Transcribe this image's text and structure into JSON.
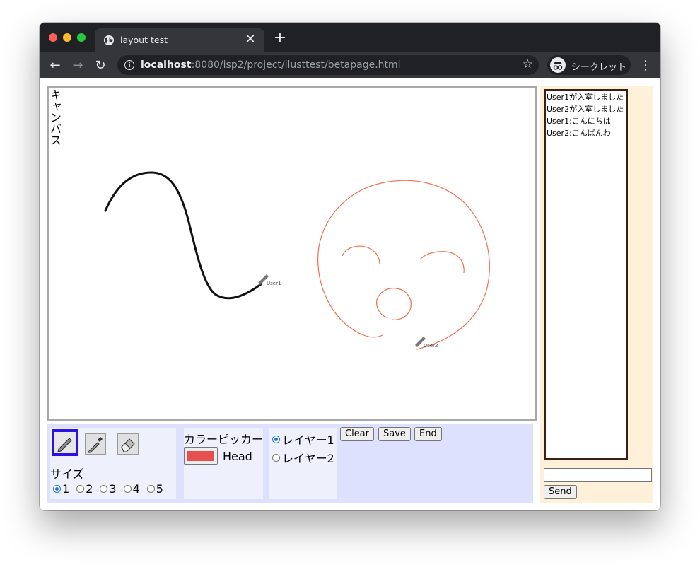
{
  "browser": {
    "tab_title": "layout test",
    "url_host": "localhost",
    "url_rest": ":8080/isp2/project/ilusttest/betapage.html",
    "incognito_label": "シークレット"
  },
  "canvas": {
    "label": "キャンバス",
    "cursor_labels": {
      "user1": "User1",
      "user2": "User2"
    }
  },
  "tools": {
    "items": [
      {
        "name": "pencil",
        "selected": true
      },
      {
        "name": "eyedropper",
        "selected": false
      },
      {
        "name": "eraser",
        "selected": false
      }
    ],
    "size_label": "サイズ",
    "sizes": [
      "1",
      "2",
      "3",
      "4",
      "5"
    ],
    "selected_size": "1"
  },
  "color": {
    "label": "カラーピッカー",
    "value": "#e85050",
    "name": "Head"
  },
  "layers": {
    "options": [
      "レイヤー1",
      "レイヤー2"
    ],
    "selected": "レイヤー1"
  },
  "actions": {
    "clear": "Clear",
    "save": "Save",
    "end": "End"
  },
  "chat": {
    "messages": [
      "User1が入室しました",
      "User2が入室しました",
      "User1:こんにちは",
      "User2:こんばんわ"
    ],
    "input_value": "",
    "send_label": "Send"
  }
}
